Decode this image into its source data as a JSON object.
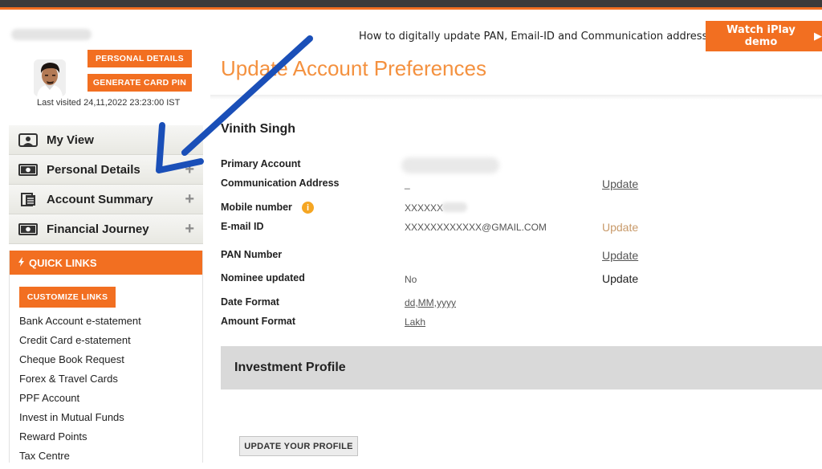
{
  "header": {
    "help_text": "How to digitally update PAN, Email-ID and Communication address?",
    "watch_button": "Watch iPlay demo"
  },
  "profile": {
    "personal_details_button": "PERSONAL DETAILS",
    "generate_pin_button": "GENERATE CARD PIN",
    "last_visited": "Last visited 24,11,2022 23:23:00 IST"
  },
  "sidebar": {
    "items": [
      {
        "label": "My View",
        "icon": "person-card-icon"
      },
      {
        "label": "Personal Details",
        "icon": "money-card-icon"
      },
      {
        "label": "Account Summary",
        "icon": "document-stack-icon"
      },
      {
        "label": "Financial Journey",
        "icon": "money-card-icon"
      }
    ]
  },
  "quick_links": {
    "title": "QUICK LINKS",
    "customize_button": "CUSTOMIZE LINKS",
    "links": [
      "Bank Account e-statement",
      "Credit Card e-statement",
      "Cheque Book Request",
      "Forex & Travel Cards",
      "PPF Account",
      "Invest in Mutual Funds",
      "Reward Points",
      "Tax Centre"
    ]
  },
  "main": {
    "title": "Update Account Preferences",
    "name": "Vinith Singh",
    "primary_account_label": "Primary Account",
    "communication_label": "Communication Address",
    "communication_value": "_",
    "communication_update": "Update",
    "mobile_label": "Mobile number",
    "mobile_value": "XXXXXX",
    "email_label": "E-mail ID",
    "email_value": "XXXXXXXXXXXX@GMAIL.COM",
    "email_update": "Update",
    "pan_label": "PAN Number",
    "pan_update": "Update",
    "nominee_label": "Nominee updated",
    "nominee_value": "No",
    "nominee_update": "Update",
    "date_format_label": "Date Format",
    "date_format_value": "dd,MM,yyyy",
    "amount_format_label": "Amount Format",
    "amount_format_value": "Lakh",
    "investment_title": "Investment Profile",
    "update_profile_button": "UPDATE YOUR PROFILE"
  },
  "colors": {
    "accent": "#f26f21",
    "title": "#f4913f",
    "arrow": "#1a4fb8",
    "topbar": "#3b3b3b"
  }
}
